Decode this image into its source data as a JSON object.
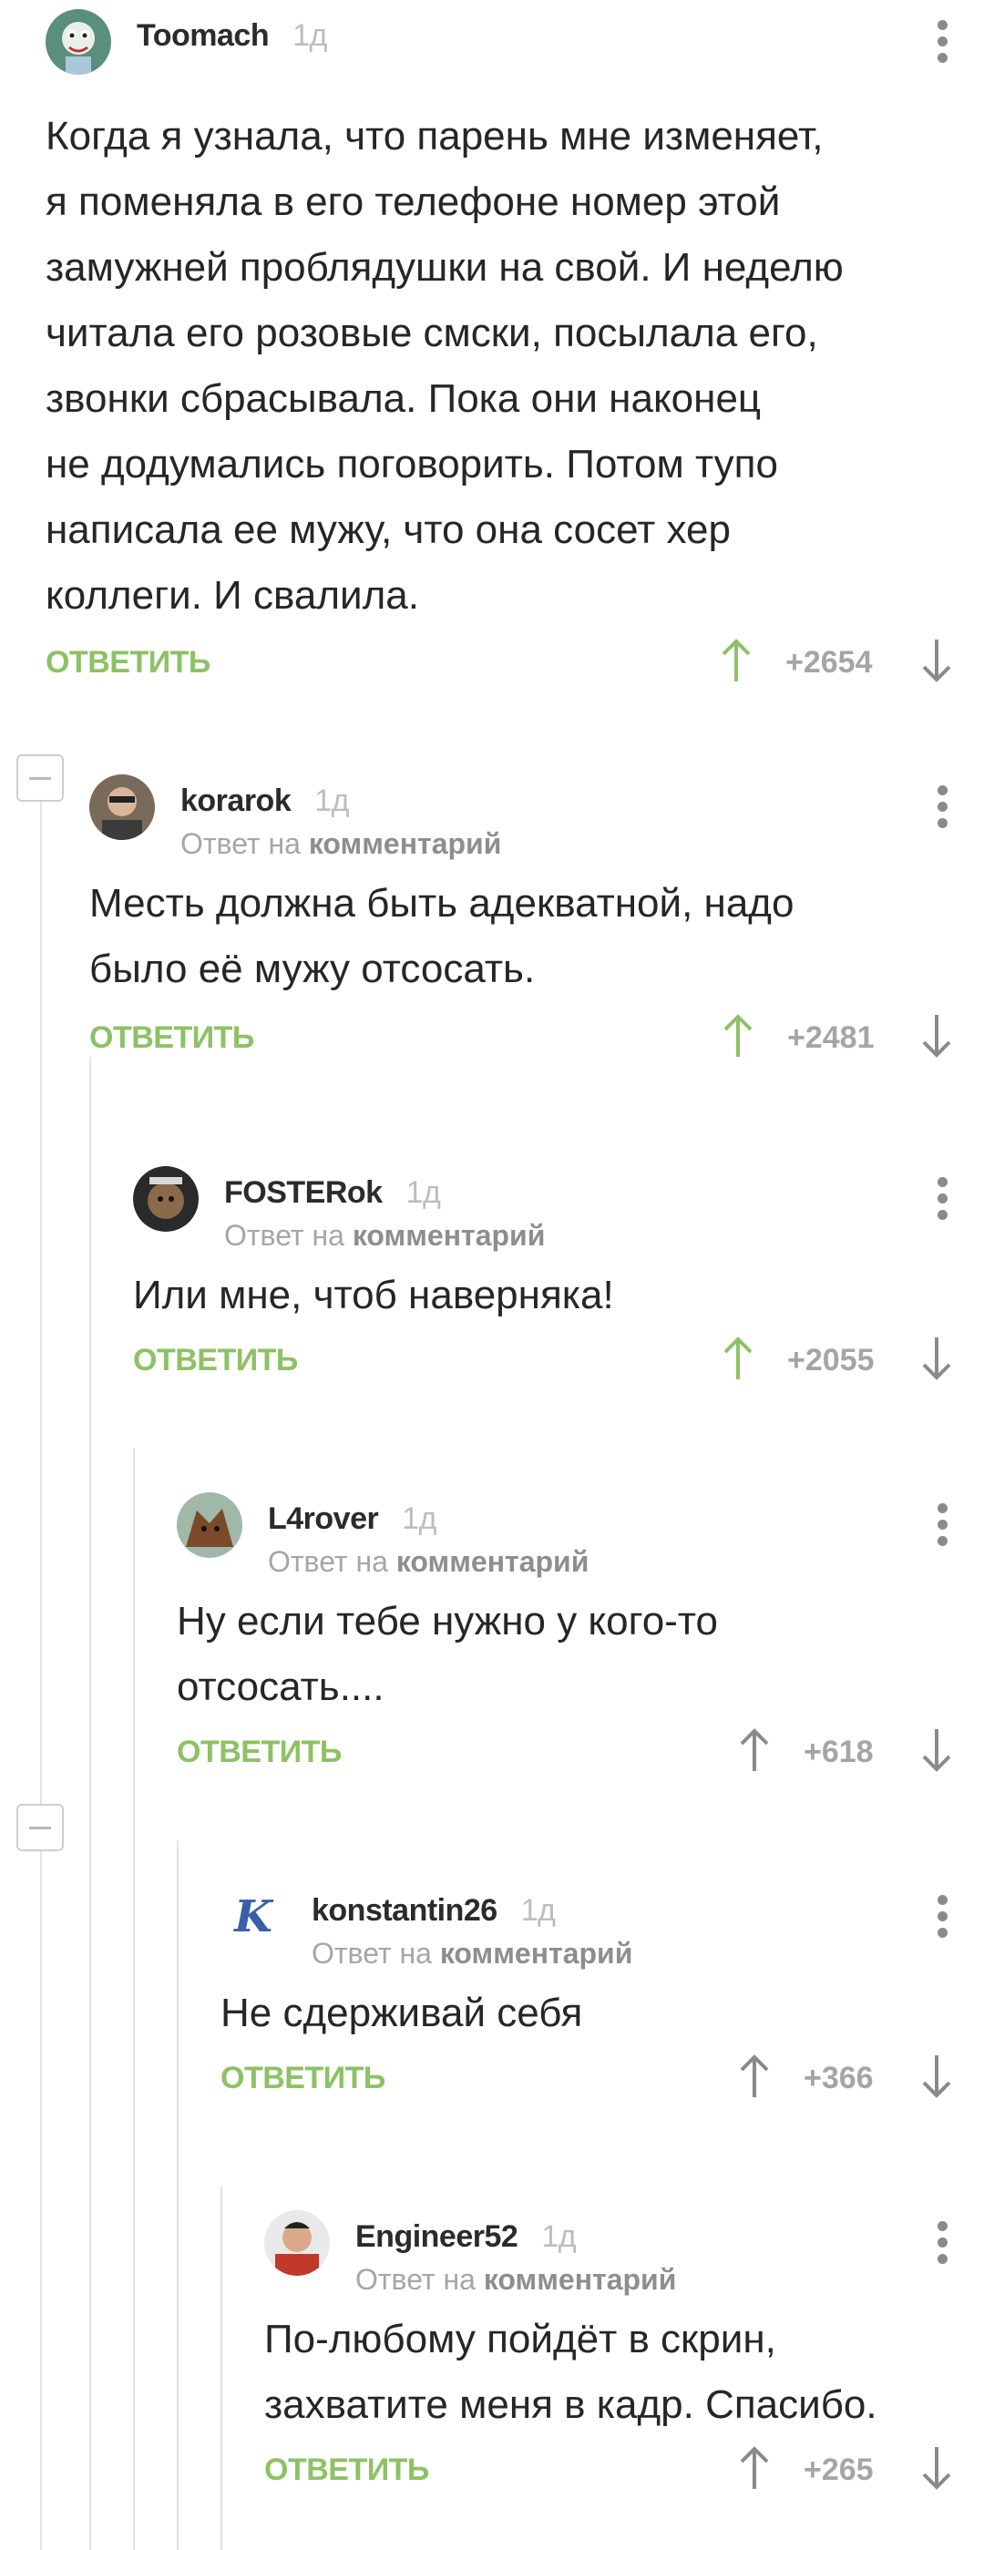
{
  "labels": {
    "reply_to_prefix": "Ответ на",
    "reply_to_target": "комментарий",
    "reply_button": "ОТВЕТИТЬ"
  },
  "colors": {
    "accent_green": "#8ec165",
    "score_grey": "#a5a5a5",
    "thread_line": "#e3e3e3"
  },
  "comments": [
    {
      "user": "Toomach",
      "time": "1д",
      "text": "Когда я узнала, что парень мне изменяет,\nя поменяла в его телефоне номер этой\nзамужней проблядушки на свой. И неделю\nчитала его розовые смски, посылала его,\nзвонки сбрасывала. Пока они наконец\nне додумались поговорить. Потом тупо\nнаписала ее мужу, что она сосет хер\nколлеги. И свалила.",
      "score": "+2654",
      "upvoted": true
    },
    {
      "user": "korarok",
      "time": "1д",
      "text": "Месть должна быть адекватной, надо\nбыло её мужу отсосать.",
      "score": "+2481",
      "upvoted": true
    },
    {
      "user": "FOSTERok",
      "time": "1д",
      "text": "Или мне, чтоб наверняка!",
      "score": "+2055",
      "upvoted": true
    },
    {
      "user": "L4rover",
      "time": "1д",
      "text": "Ну если тебе нужно у кого-то\nотсосать....",
      "score": "+618",
      "upvoted": false
    },
    {
      "user": "konstantin26",
      "time": "1д",
      "text": "Не сдерживай себя",
      "score": "+366",
      "upvoted": false
    },
    {
      "user": "Engineer52",
      "time": "1д",
      "text": "По-любому пойдёт в скрин,\nзахватите меня в кадр. Спасибо.",
      "score": "+265",
      "upvoted": false
    }
  ]
}
